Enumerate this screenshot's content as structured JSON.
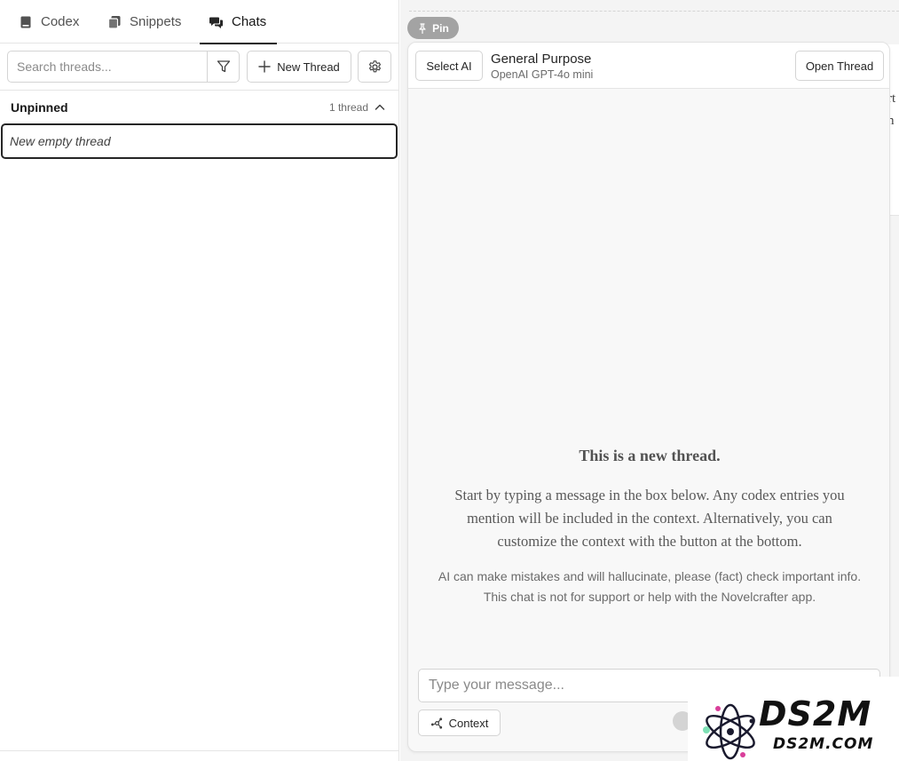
{
  "sidebar": {
    "tabs": [
      {
        "label": "Codex",
        "icon": "book-icon"
      },
      {
        "label": "Snippets",
        "icon": "snippets-icon"
      },
      {
        "label": "Chats",
        "icon": "chat-bubbles-icon",
        "active": true
      }
    ],
    "search": {
      "placeholder": "Search threads..."
    },
    "new_thread_label": "New Thread",
    "group": {
      "title": "Unpinned",
      "count": "1 thread"
    },
    "threads": [
      {
        "title": "New empty thread"
      }
    ]
  },
  "chat": {
    "pin_label": "Pin",
    "select_ai_label": "Select AI",
    "ai_name": "General Purpose",
    "ai_model": "OpenAI GPT-4o mini",
    "open_thread_label": "Open Thread",
    "empty_title": "This is a new thread.",
    "empty_body": "Start by typing a message in the box below. Any codex entries you mention will be included in the context. Alternatively, you can customize the context with the button at the bottom.",
    "disclaimer": "AI can make mistakes and will hallucinate, please (fact) check important info. This chat is not for support or help with the Novelcrafter app.",
    "input_placeholder": "Type your message...",
    "context_label": "Context"
  },
  "background_doc": {
    "line1": "rt",
    "line2": "n"
  },
  "watermark": {
    "big": "DS2M",
    "small": "DS2M.COM"
  },
  "colors": {
    "text": "#262626",
    "border": "#d4d4d4",
    "pin_bg": "#a3a3a3",
    "panel_bg": "#f8f8f8"
  }
}
